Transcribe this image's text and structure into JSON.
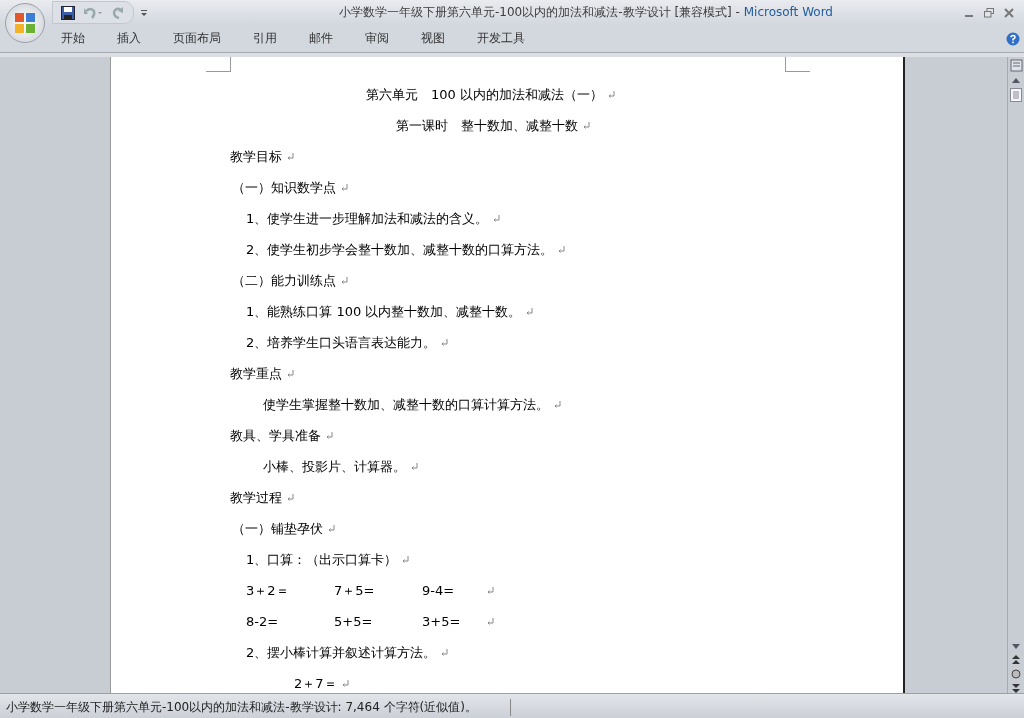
{
  "window": {
    "title": "小学数学一年级下册第六单元-100以内的加法和减法-教学设计 [兼容模式]",
    "separator": "-",
    "app_name": "Microsoft Word"
  },
  "ribbon_tabs": [
    {
      "label": "开始",
      "selected": false
    },
    {
      "label": "插入",
      "selected": false
    },
    {
      "label": "页面布局",
      "selected": false
    },
    {
      "label": "引用",
      "selected": false
    },
    {
      "label": "邮件",
      "selected": false
    },
    {
      "label": "审阅",
      "selected": false
    },
    {
      "label": "视图",
      "selected": false
    },
    {
      "label": "开发工具",
      "selected": false
    }
  ],
  "document": {
    "paragraphs": [
      {
        "kind": "title",
        "text": "第六单元　100 以内的加法和减法（一）"
      },
      {
        "kind": "subtitle",
        "text": "第一课时　整十数加、减整十数"
      },
      {
        "kind": "heading",
        "text": "教学目标"
      },
      {
        "kind": "subheading",
        "text": "（一）知识数学点"
      },
      {
        "kind": "item",
        "text": "1、使学生进一步理解加法和减法的含义。"
      },
      {
        "kind": "item",
        "text": "2、使学生初步学会整十数加、减整十数的口算方法。"
      },
      {
        "kind": "subheading",
        "text": "（二）能力训练点"
      },
      {
        "kind": "item",
        "text": "1、能熟练口算 100 以内整十数加、减整十数。"
      },
      {
        "kind": "item",
        "text": "2、培养学生口头语言表达能力。"
      },
      {
        "kind": "heading",
        "text": "教学重点"
      },
      {
        "kind": "body",
        "text": "使学生掌握整十数加、减整十数的口算计算方法。"
      },
      {
        "kind": "heading",
        "text": "教具、学具准备"
      },
      {
        "kind": "body",
        "text": "小棒、投影片、计算器。"
      },
      {
        "kind": "heading",
        "text": "教学过程"
      },
      {
        "kind": "subheading",
        "text": "（一）铺垫孕伏"
      },
      {
        "kind": "item",
        "text": "1、口算：（出示口算卡）"
      },
      {
        "kind": "formulas",
        "cells": [
          "3＋2＝",
          "7＋5=",
          "9-4="
        ]
      },
      {
        "kind": "formulas",
        "cells": [
          "8-2=",
          "5+5=",
          "3+5="
        ]
      },
      {
        "kind": "item",
        "text": "2、摆小棒计算并叙述计算方法。"
      },
      {
        "kind": "formula",
        "text": "2＋7＝"
      }
    ]
  },
  "status_bar": {
    "text": "小学数学一年级下册第六单元-100以内的加法和减法-教学设计: 7,464 个字符(近似值)。"
  }
}
